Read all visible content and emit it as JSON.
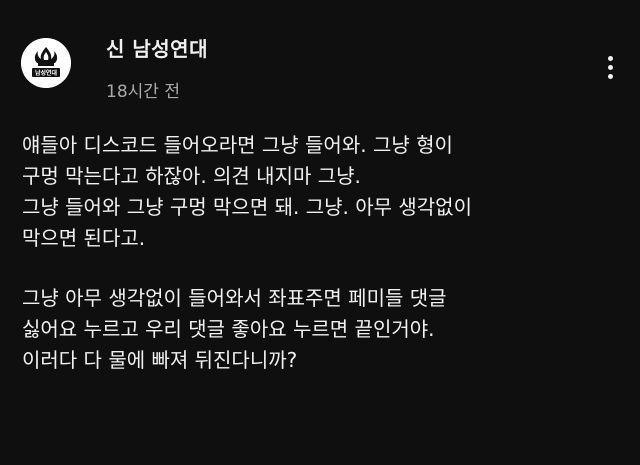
{
  "post": {
    "channel_name": "신 남성연대",
    "time": "18시간 전",
    "avatar": {
      "label": "남성연대",
      "icon": "flame-logo-icon"
    },
    "more_icon": "more-vertical-icon",
    "paragraphs": [
      [
        "얘들아 디스코드 들어오라면 그냥 들어와. 그냥 형이",
        "구멍 막는다고 하잖아. 의견 내지마 그냥.",
        "그냥 들어와 그냥 구멍 막으면 돼. 그냥. 아무 생각없이",
        "막으면 된다고."
      ],
      [
        "그냥 아무 생각없이 들어와서 좌표주면 페미들 댓글",
        "싫어요 누르고 우리 댓글 좋아요 누르면 끝인거야.",
        "이러다 다 물에 빠져 뒤진다니까?"
      ]
    ]
  }
}
